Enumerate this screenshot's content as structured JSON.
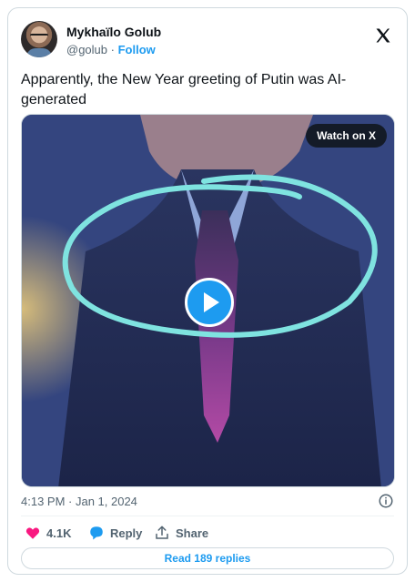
{
  "author": {
    "name": "Mykhaïlo Golub",
    "handle": "@golub",
    "separator": "·",
    "follow_label": "Follow"
  },
  "tweet": {
    "text": "Apparently, the New Year greeting of Putin was AI-generated"
  },
  "media": {
    "watch_label": "Watch on X",
    "play_icon": "play-icon"
  },
  "meta": {
    "timestamp": "4:13 PM · Jan 1, 2024"
  },
  "actions": {
    "likes_count": "4.1K",
    "reply_label": "Reply",
    "share_label": "Share"
  },
  "footer": {
    "replies_label": "Read 189 replies"
  },
  "colors": {
    "accent": "#1d9bf0",
    "like": "#f91880",
    "annotation": "#7fe3e0"
  }
}
